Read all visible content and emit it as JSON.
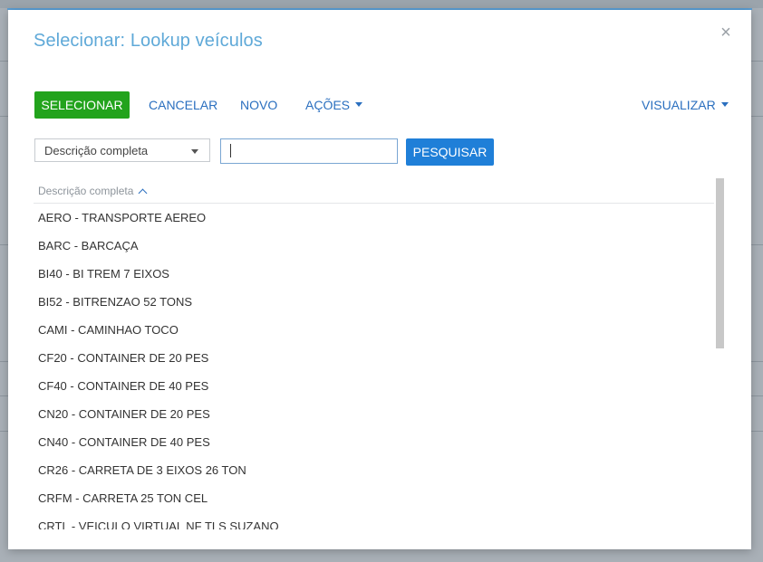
{
  "dialog": {
    "title": "Selecionar: Lookup veículos",
    "close_glyph": "×"
  },
  "toolbar": {
    "select_label": "SELECIONAR",
    "cancel_label": "CANCELAR",
    "new_label": "NOVO",
    "actions_label": "AÇÕES",
    "view_label": "VISUALIZAR"
  },
  "filter": {
    "field_value": "Descrição completa",
    "search_value": "",
    "search_button": "PESQUISAR"
  },
  "grid": {
    "column_header": "Descrição completa",
    "sort": "ascending",
    "rows": [
      "AERO - TRANSPORTE AEREO",
      "BARC - BARCAÇA",
      "BI40 - BI TREM 7 EIXOS",
      "BI52 - BITRENZAO 52 TONS",
      "CAMI - CAMINHAO TOCO",
      "CF20 - CONTAINER DE 20 PES",
      "CF40 - CONTAINER DE 40 PES",
      "CN20 - CONTAINER DE 20 PES",
      "CN40 - CONTAINER DE 40 PES",
      "CR26 - CARRETA DE 3 EIXOS 26 TON",
      "CRFM - CARRETA 25 TON CEL",
      "CRTL - VEICULO VIRTUAL NF TLS SUZANO"
    ]
  },
  "colors": {
    "title": "#5fa9d8",
    "primary_button": "#22a31c",
    "search_button": "#1f7fd8",
    "link": "#2a6fbf"
  }
}
